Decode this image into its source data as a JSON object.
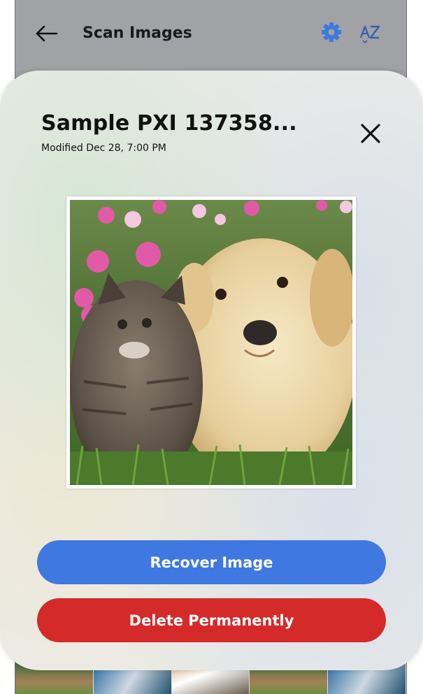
{
  "header": {
    "title": "Scan Images",
    "back_icon": "arrow-left-icon",
    "settings_icon": "gear-icon",
    "sort_icon": "sort-az-icon",
    "accent_color": "#3f78e0"
  },
  "dialog": {
    "title": "Sample PXI 137358...",
    "modified": "Modified Dec 28, 7:00 PM",
    "close_icon": "close-icon",
    "preview_subject": "puppy-and-kitten-photo",
    "recover_label": "Recover Image",
    "recover_color": "#3f78e0",
    "delete_label": "Delete Permanently",
    "delete_color": "#d42a2a"
  }
}
